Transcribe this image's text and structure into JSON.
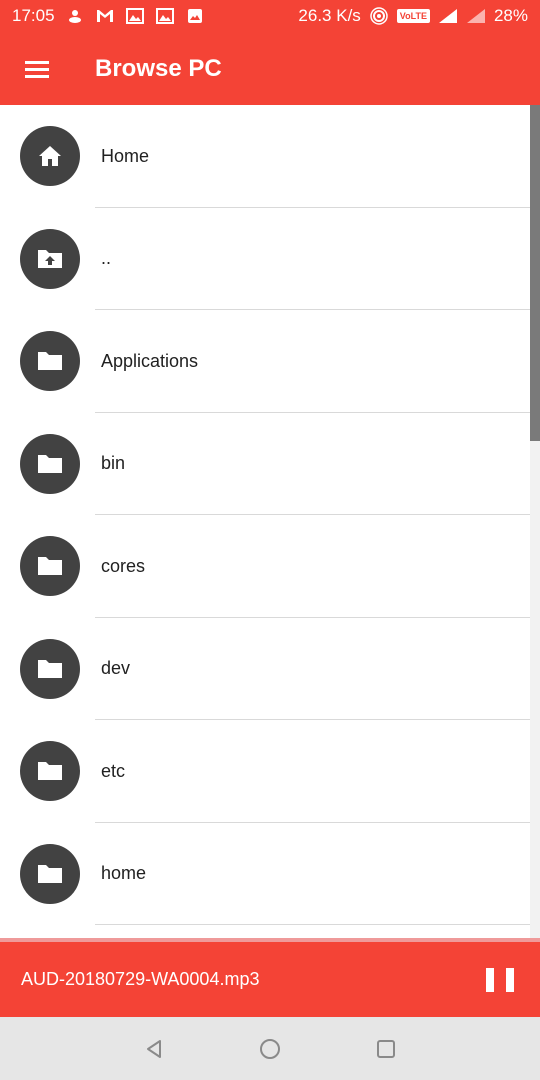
{
  "status": {
    "time": "17:05",
    "speed": "26.3 K/s",
    "volte": "VoLTE",
    "battery": "28%"
  },
  "appbar": {
    "title": "Browse PC"
  },
  "list": {
    "items": [
      {
        "label": "Home",
        "icon": "home-icon"
      },
      {
        "label": "..",
        "icon": "folder-up-icon"
      },
      {
        "label": "Applications",
        "icon": "folder-icon"
      },
      {
        "label": "bin",
        "icon": "folder-icon"
      },
      {
        "label": "cores",
        "icon": "folder-icon"
      },
      {
        "label": "dev",
        "icon": "folder-icon"
      },
      {
        "label": "etc",
        "icon": "folder-icon"
      },
      {
        "label": "home",
        "icon": "folder-icon"
      }
    ]
  },
  "player": {
    "track": "AUD-20180729-WA0004.mp3"
  },
  "colors": {
    "accent": "#f44336",
    "avatar": "#424242"
  }
}
